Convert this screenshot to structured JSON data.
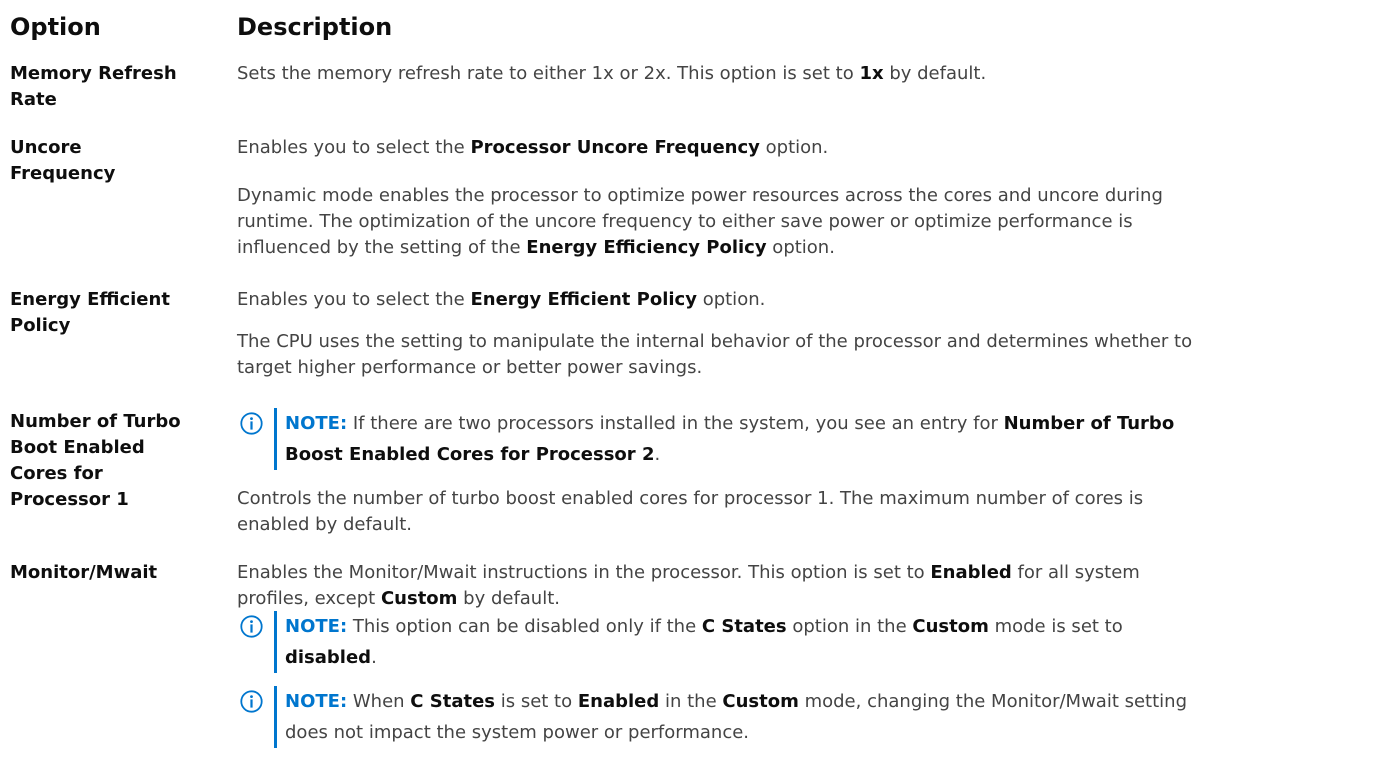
{
  "header": {
    "option": "Option",
    "description": "Description"
  },
  "rows": {
    "memory_refresh": {
      "option_line1": "Memory Refresh",
      "option_line2": "Rate",
      "desc_pre": "Sets the memory refresh rate to either 1x or 2x. This option is set to ",
      "desc_bold": "1x",
      "desc_post": " by default."
    },
    "uncore": {
      "option_line1": "Uncore",
      "option_line2": "Frequency",
      "desc1_pre": "Enables you to select the ",
      "desc1_bold": "Processor Uncore Frequency",
      "desc1_post": " option.",
      "desc2_line1": "Dynamic mode enables the processor to optimize power resources across the cores and uncore during",
      "desc2_line2": "runtime. The optimization of the uncore frequency to either save power or optimize performance is",
      "desc2_line3_pre": "influenced by the setting of the ",
      "desc2_line3_bold": "Energy Efficiency Policy",
      "desc2_line3_post": " option."
    },
    "energy": {
      "option_line1": "Energy Efficient",
      "option_line2": "Policy",
      "desc1_pre": "Enables you to select the ",
      "desc1_bold": "Energy Efficient Policy",
      "desc1_post": " option.",
      "desc2_line1": "The CPU uses the setting to manipulate the internal behavior of the processor and determines whether to",
      "desc2_line2": "target higher performance or better power savings."
    },
    "turbo": {
      "option_line1": "Number of Turbo",
      "option_line2": "Boot Enabled",
      "option_line3": "Cores for",
      "option_line4": "Processor 1",
      "note_label": "NOTE:",
      "note_line1_text": " If there are two processors installed in the system, you see an entry for ",
      "note_line1_bold": "Number of Turbo",
      "note_line2_bold": "Boost Enabled Cores for Processor 2",
      "note_line2_post": ".",
      "desc_line1": "Controls the number of turbo boost enabled cores for processor 1. The maximum number of cores is",
      "desc_line2": "enabled by default."
    },
    "monitor": {
      "option_line1": "Monitor/Mwait",
      "desc_line1_pre": "Enables the Monitor/Mwait instructions in the processor. This option is set to ",
      "desc_line1_bold": "Enabled",
      "desc_line1_post": " for all system",
      "desc_line2_pre": "profiles, except ",
      "desc_line2_bold": "Custom",
      "desc_line2_post": " by default.",
      "note1_label": "NOTE:",
      "note1_a": " This option can be disabled only if the ",
      "note1_b": "C States",
      "note1_c": " option in the ",
      "note1_d": "Custom",
      "note1_e": " mode is set to",
      "note1_f": "disabled",
      "note1_g": ".",
      "note2_label": "NOTE:",
      "note2_a": " When ",
      "note2_b": "C States",
      "note2_c": " is set to ",
      "note2_d": "Enabled",
      "note2_e": " in the ",
      "note2_f": "Custom",
      "note2_g": " mode, changing the Monitor/Mwait setting",
      "note2_line2": "does not impact the system power or performance."
    }
  },
  "icons": {
    "note_icon": "info-circle-icon",
    "accent_color": "#0076ce"
  }
}
